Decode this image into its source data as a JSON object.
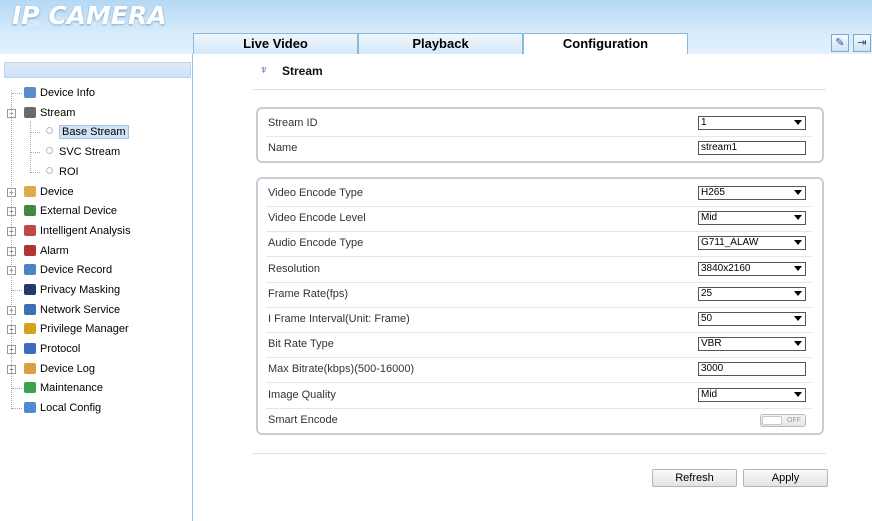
{
  "app": {
    "logo": "IP CAMERA"
  },
  "tabs": [
    {
      "label": "Live Video",
      "active": false
    },
    {
      "label": "Playback",
      "active": false
    },
    {
      "label": "Configuration",
      "active": true
    }
  ],
  "header_icons": [
    {
      "name": "edit-icon",
      "glyph": "✎"
    },
    {
      "name": "logout-icon",
      "glyph": "⇥"
    }
  ],
  "sidebar": {
    "items": [
      {
        "label": "Device Info",
        "icon": "device-info-icon",
        "color": "#5b8ec8"
      },
      {
        "label": "Stream",
        "icon": "stream-icon",
        "color": "#6b6b6b",
        "expanded": true,
        "children": [
          {
            "label": "Base Stream",
            "selected": true
          },
          {
            "label": "SVC Stream"
          },
          {
            "label": "ROI"
          }
        ]
      },
      {
        "label": "Device",
        "icon": "device-icon",
        "color": "#e0a94b"
      },
      {
        "label": "External Device",
        "icon": "external-device-icon",
        "color": "#3f8a3f"
      },
      {
        "label": "Intelligent Analysis",
        "icon": "intelligent-analysis-icon",
        "color": "#c04848"
      },
      {
        "label": "Alarm",
        "icon": "alarm-icon",
        "color": "#b03434"
      },
      {
        "label": "Device Record",
        "icon": "device-record-icon",
        "color": "#4a84c4"
      },
      {
        "label": "Privacy Masking",
        "icon": "privacy-masking-icon",
        "color": "#223a6e"
      },
      {
        "label": "Network Service",
        "icon": "network-service-icon",
        "color": "#3c6fb4"
      },
      {
        "label": "Privilege Manager",
        "icon": "privilege-manager-icon",
        "color": "#d4a21c"
      },
      {
        "label": "Protocol",
        "icon": "protocol-icon",
        "color": "#3b6cc2"
      },
      {
        "label": "Device Log",
        "icon": "device-log-icon",
        "color": "#d8a040"
      },
      {
        "label": "Maintenance",
        "icon": "maintenance-icon",
        "color": "#3aa34a"
      },
      {
        "label": "Local Config",
        "icon": "local-config-icon",
        "color": "#4f8bd0"
      }
    ]
  },
  "page": {
    "title": "Stream",
    "title_icon": "stream-icon"
  },
  "panel1": {
    "rows": [
      {
        "label": "Stream ID",
        "type": "select",
        "value": "1"
      },
      {
        "label": "Name",
        "type": "input",
        "value": "stream1"
      }
    ]
  },
  "panel2": {
    "rows": [
      {
        "label": "Video Encode Type",
        "type": "select",
        "value": "H265"
      },
      {
        "label": "Video Encode Level",
        "type": "select",
        "value": "Mid"
      },
      {
        "label": "Audio Encode Type",
        "type": "select",
        "value": "G711_ALAW"
      },
      {
        "label": "Resolution",
        "type": "select",
        "value": "3840x2160"
      },
      {
        "label": "Frame Rate(fps)",
        "type": "select",
        "value": "25"
      },
      {
        "label": "I Frame Interval(Unit: Frame)",
        "type": "select",
        "value": "50"
      },
      {
        "label": "Bit Rate Type",
        "type": "select",
        "value": "VBR"
      },
      {
        "label": "Max Bitrate(kbps)(500-16000)",
        "type": "input",
        "value": "3000"
      },
      {
        "label": "Image Quality",
        "type": "select",
        "value": "Mid"
      },
      {
        "label": "Smart Encode",
        "type": "toggle",
        "value": "OFF"
      }
    ]
  },
  "buttons": {
    "refresh": "Refresh",
    "apply": "Apply"
  }
}
